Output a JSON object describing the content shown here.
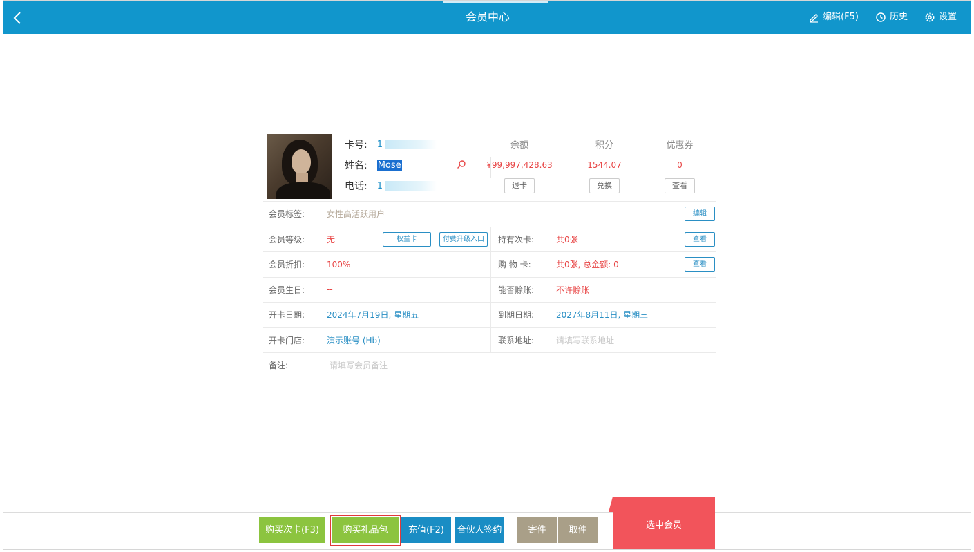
{
  "header": {
    "title": "会员中心",
    "actions": [
      {
        "label": "编辑(F5)",
        "icon": "pencil-icon"
      },
      {
        "label": "历史",
        "icon": "history-icon"
      },
      {
        "label": "设置",
        "icon": "gear-icon"
      }
    ]
  },
  "member": {
    "card_label": "卡号:",
    "card_value": "1",
    "name_label": "姓名:",
    "name_value": "Mose",
    "phone_label": "电话:",
    "phone_value": "1"
  },
  "stats": {
    "balance": {
      "label": "余额",
      "value": "¥99,997,428.63",
      "button": "退卡"
    },
    "points": {
      "label": "积分",
      "value": "1544.07",
      "button": "兑换"
    },
    "coupons": {
      "label": "优惠券",
      "value": "0",
      "button": "查看"
    }
  },
  "details": {
    "tag": {
      "label": "会员标签:",
      "value": "女性高活跃用户",
      "button": "编辑"
    },
    "level": {
      "label": "会员等级:",
      "value": "无",
      "btn_rights": "权益卡",
      "btn_upgrade": "付费升级入口"
    },
    "times_card": {
      "label": "持有次卡:",
      "value": "共0张",
      "button": "查看"
    },
    "discount": {
      "label": "会员折扣:",
      "value": "100%"
    },
    "shopping_card": {
      "label": "购 物 卡:",
      "value": "共0张, 总金额: 0",
      "button": "查看"
    },
    "birthday": {
      "label": "会员生日:",
      "value": "--"
    },
    "credit": {
      "label": "能否赊账:",
      "value": "不许赊账"
    },
    "open_date": {
      "label": "开卡日期:",
      "value": "2024年7月19日, 星期五"
    },
    "expire_date": {
      "label": "到期日期:",
      "value": "2027年8月11日, 星期三"
    },
    "store": {
      "label": "开卡门店:",
      "value": "演示账号 (Hb)"
    },
    "address": {
      "label": "联系地址:",
      "placeholder": "请填写联系地址"
    },
    "note": {
      "label": "备注:",
      "placeholder": "请填写会员备注"
    }
  },
  "footer": {
    "buy_times_card": "购买次卡(F3)",
    "buy_gift_pack": "购买礼品包",
    "recharge": "充值(F2)",
    "partner_sign": "合伙人签约",
    "deposit": "寄件",
    "pickup": "取件",
    "select_member": "选中会员"
  },
  "colors": {
    "header_bg": "#1196cc",
    "accent_red": "#e84545",
    "green_button": "#8cc43f",
    "blue_button": "#1a8dc4",
    "gray_button": "#a99f88",
    "select_member_bg": "#f2545b"
  }
}
